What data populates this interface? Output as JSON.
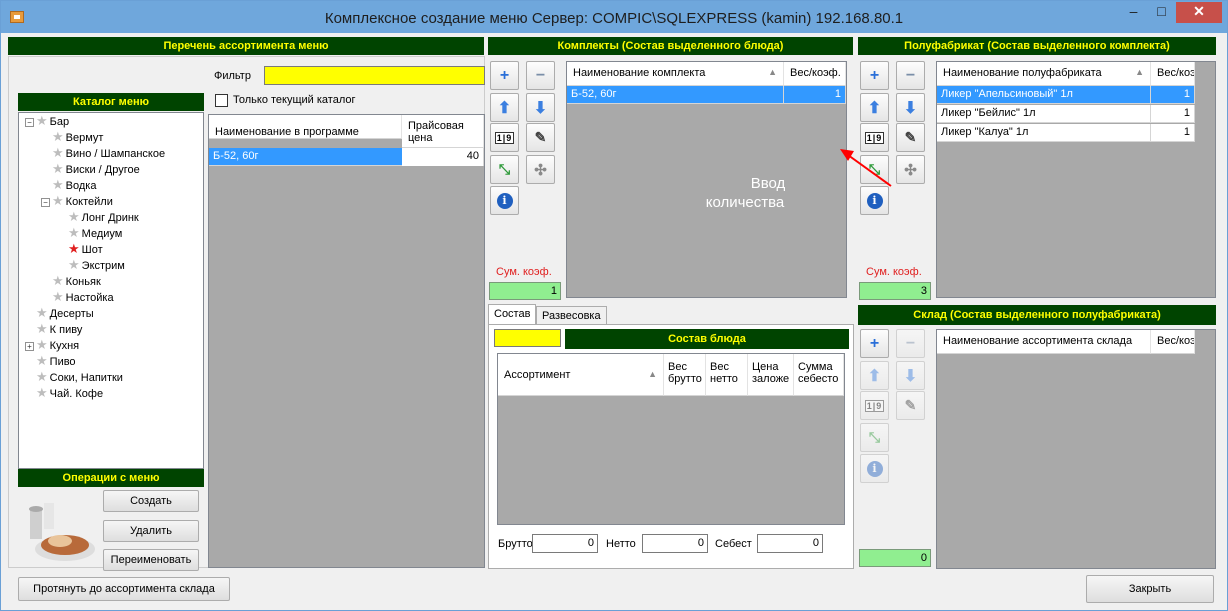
{
  "window": {
    "title": "Комплексное создание меню  Сервер: COMPIC\\SQLEXPRESS (kamin) 192.168.80.1",
    "min": "‒",
    "max": "□",
    "close": "✕"
  },
  "assortment": {
    "header": "Перечень ассортимента меню",
    "filter_label": "Фильтр",
    "filter_value": "",
    "only_current_label": "Только текущий каталог",
    "columns": [
      "Наименование в программе",
      "Прайсовая цена"
    ],
    "rows": [
      {
        "name": "Б-52, 60г",
        "price": "40"
      }
    ]
  },
  "catalog": {
    "header": "Каталог меню",
    "items": [
      {
        "label": "Бар",
        "exp": "−"
      },
      {
        "label": "Вермут"
      },
      {
        "label": "Вино / Шампанское"
      },
      {
        "label": "Виски / Другое"
      },
      {
        "label": "Водка"
      },
      {
        "label": "Коктейли",
        "exp": "−"
      },
      {
        "label": "Лонг Дринк"
      },
      {
        "label": "Медиум"
      },
      {
        "label": "Шот"
      },
      {
        "label": "Экстрим"
      },
      {
        "label": "Коньяк"
      },
      {
        "label": "Настойка"
      },
      {
        "label": "Десерты"
      },
      {
        "label": "К пиву"
      },
      {
        "label": "Кухня",
        "exp": "+"
      },
      {
        "label": "Пиво"
      },
      {
        "label": "Соки, Напитки"
      },
      {
        "label": "Чай. Кофе"
      }
    ]
  },
  "ops": {
    "header": "Операции с меню",
    "create": "Создать",
    "delete": "Удалить",
    "rename": "Переименовать"
  },
  "bottom": {
    "extend": "Протянуть до ассортимента склада",
    "close": "Закрыть"
  },
  "kits": {
    "header": "Комплекты (Состав выделенного блюда)",
    "columns": [
      "Наименование комплекта",
      "Вес/коэф."
    ],
    "rows": [
      {
        "name": "Б-52, 60г",
        "coef": "1"
      }
    ],
    "sum_label": "Сум. коэф.",
    "sum_value": "1"
  },
  "tabs": [
    "Состав",
    "Развесовка"
  ],
  "dish": {
    "header": "Состав блюда",
    "columns": [
      "Ассортимент",
      "Вес брутто",
      "Вес нетто",
      "Цена заложе",
      "Сумма себесто"
    ],
    "brutto_label": "Брутто",
    "brutto": "0",
    "netto_label": "Нетто",
    "netto": "0",
    "cost_label": "Себест",
    "cost": "0"
  },
  "semi": {
    "header": "Полуфабрикат (Состав выделенного комплекта)",
    "columns": [
      "Наименование полуфабриката",
      "Вес/коэ"
    ],
    "rows": [
      {
        "name": "Ликер \"Апельсиновый\" 1л",
        "coef": "1"
      },
      {
        "name": "Ликер \"Бейлис\" 1л",
        "coef": "1"
      },
      {
        "name": "Ликер \"Калуа\" 1л",
        "coef": "1"
      }
    ],
    "sum_label": "Сум. коэф.",
    "sum_value": "3"
  },
  "annotation": {
    "line1": "Ввод",
    "line2": "количества"
  },
  "warehouse": {
    "header": "Склад (Состав выделенного полуфабриката)",
    "columns": [
      "Наименование ассортимента склада",
      "Вес/коэ"
    ],
    "sum_value": "0"
  },
  "icons": {
    "plus": "+",
    "minus": "−",
    "up": "⬆",
    "down": "⬇",
    "qty": "1|9",
    "edit": "✎",
    "collapse": "⤡",
    "puzzle": "✣",
    "info": "i",
    "star": "★",
    "sort": "▲"
  }
}
